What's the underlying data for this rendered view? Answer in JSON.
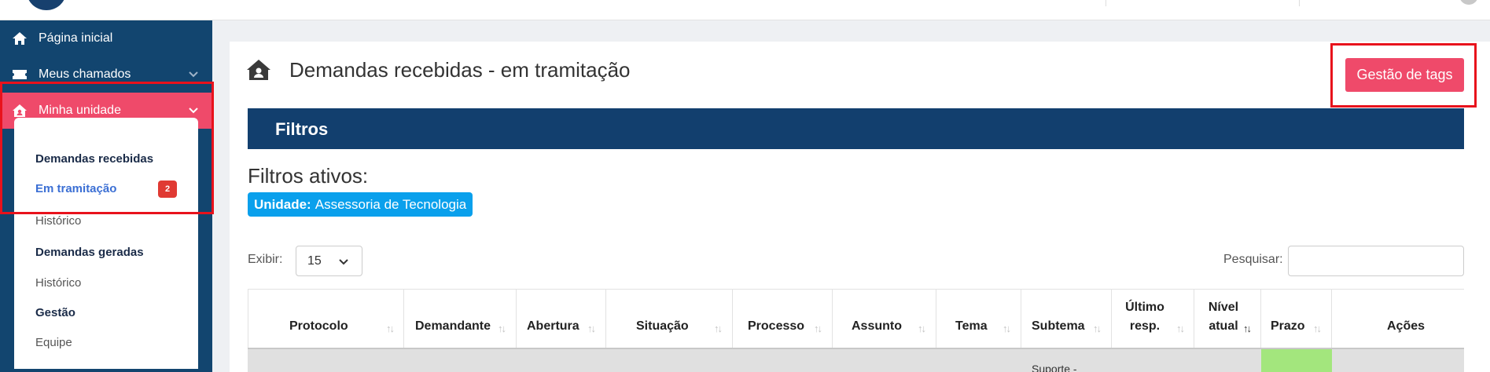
{
  "sidebar": {
    "home_label": "Página inicial",
    "chamados_label": "Meus chamados",
    "unidade_label": "Minha unidade",
    "submenu": {
      "demandas_recebidas": "Demandas recebidas",
      "em_tramitacao": "Em tramitação",
      "em_tramitacao_badge": "2",
      "historico_1": "Histórico",
      "demandas_geradas": "Demandas geradas",
      "historico_2": "Histórico",
      "gestao": "Gestão",
      "equipe": "Equipe"
    }
  },
  "main": {
    "title": "Demandas recebidas - em tramitação",
    "tags_button": "Gestão de tags",
    "filters_title": "Filtros",
    "active_filters_label": "Filtros ativos:",
    "chip_key": "Unidade:",
    "chip_value": "Assessoria de Tecnologia",
    "exibir_label": "Exibir:",
    "exibir_value": "15",
    "search_label": "Pesquisar:"
  },
  "table": {
    "columns": [
      "Protocolo",
      "Demandante",
      "Abertura",
      "Situação",
      "Processo",
      "Assunto",
      "Tema",
      "Subtema",
      "Último resp.",
      "Nível atual",
      "Prazo",
      "Ações"
    ],
    "row_partial_text": "Suporte -"
  },
  "colors": {
    "sidebar": "#12456f",
    "accent": "#ef4a6a",
    "filters_bar": "#123f6e",
    "chip": "#0aa0ec",
    "badge": "#e03a33",
    "prazo_ok": "#a3e67d"
  }
}
